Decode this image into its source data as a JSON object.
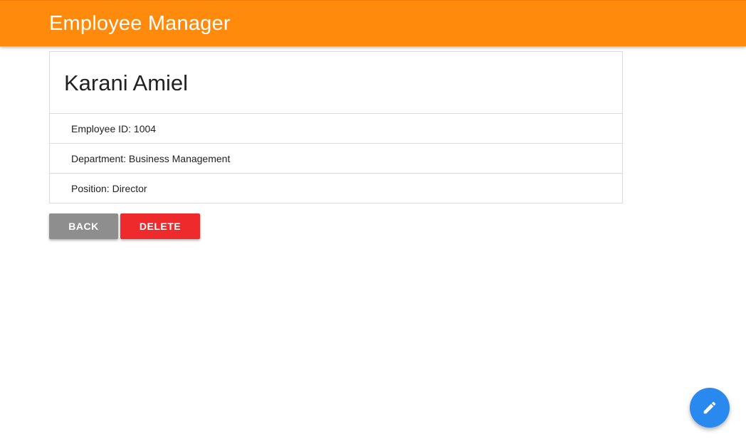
{
  "app": {
    "title": "Employee Manager",
    "header_color": "#ff8a0c"
  },
  "employee": {
    "name": "Karani Amiel",
    "details": [
      "Employee ID: 1004",
      "Department: Business Management",
      "Position: Director"
    ]
  },
  "actions": {
    "back_label": "BACK",
    "delete_label": "DELETE",
    "back_color": "#8e8e8e",
    "delete_color": "#ee2a2d"
  },
  "fab": {
    "icon": "pencil-icon",
    "color": "#2a89ef"
  }
}
